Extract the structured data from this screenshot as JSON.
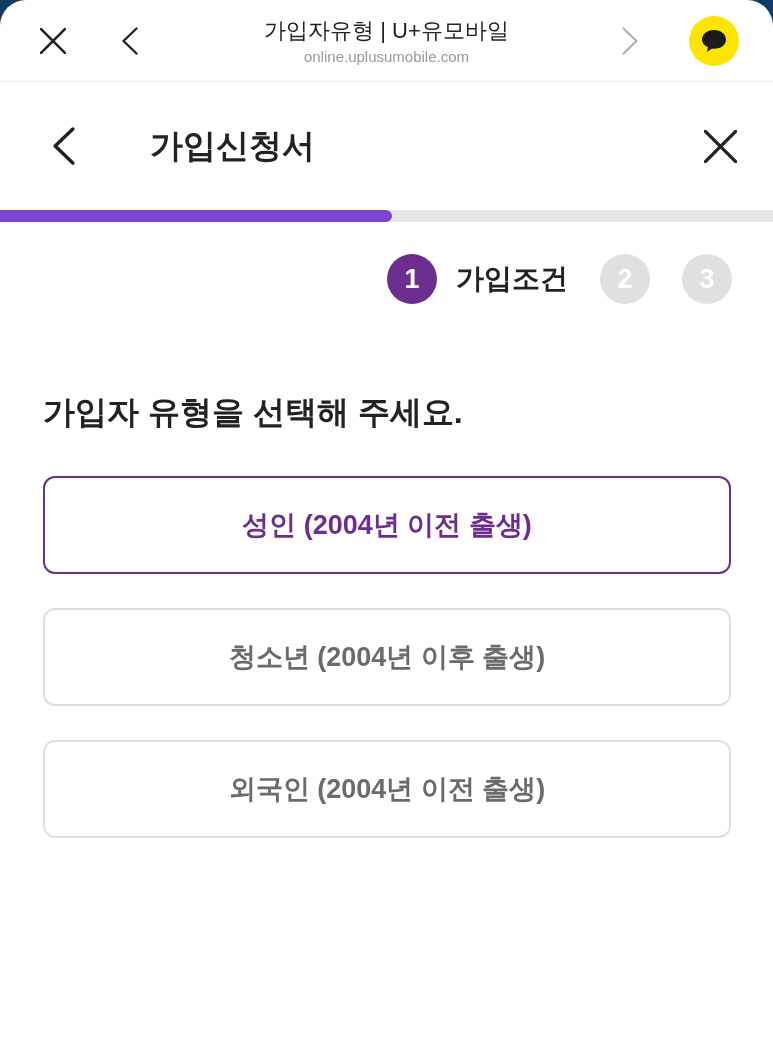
{
  "browser_bar": {
    "title": "가입자유형 | U+유모바일",
    "url": "online.uplusumobile.com"
  },
  "header": {
    "title": "가입신청서"
  },
  "progress": {
    "level": 0.507
  },
  "steps": [
    {
      "number": "1",
      "label": "가입조건",
      "selected": true
    },
    {
      "number": "2",
      "selected": false
    },
    {
      "number": "3",
      "selected": false
    }
  ],
  "question": "가입자 유형을 선택해 주세요.",
  "options": [
    {
      "label": "성인 (2004년 이전 출생)",
      "selected": true
    },
    {
      "label": "청소년 (2004년 이후 출생)",
      "selected": false
    },
    {
      "label": "외국인 (2004년 이전 출생)",
      "selected": false
    }
  ]
}
